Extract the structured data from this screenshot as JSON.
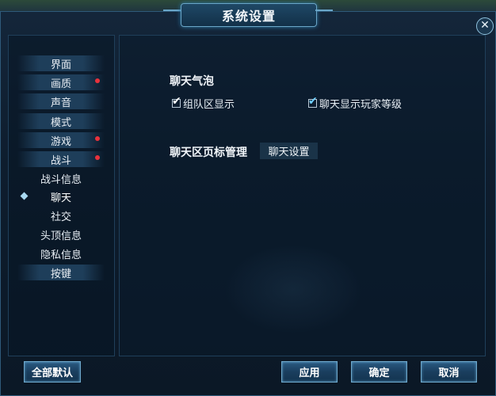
{
  "window": {
    "title": "系统设置"
  },
  "sidebar": {
    "items": [
      {
        "label": "界面",
        "style": "button",
        "has_dot": false
      },
      {
        "label": "画质",
        "style": "button",
        "has_dot": true
      },
      {
        "label": "声音",
        "style": "button",
        "has_dot": false
      },
      {
        "label": "模式",
        "style": "button",
        "has_dot": false
      },
      {
        "label": "游戏",
        "style": "button",
        "has_dot": true
      },
      {
        "label": "战斗",
        "style": "button",
        "has_dot": true
      },
      {
        "label": "战斗信息",
        "style": "plain",
        "has_dot": false
      },
      {
        "label": "聊天",
        "style": "plain",
        "has_dot": false,
        "active": true
      },
      {
        "label": "社交",
        "style": "plain",
        "has_dot": false
      },
      {
        "label": "头顶信息",
        "style": "plain",
        "has_dot": false
      },
      {
        "label": "隐私信息",
        "style": "plain",
        "has_dot": false
      },
      {
        "label": "按键",
        "style": "button",
        "has_dot": false
      }
    ]
  },
  "content": {
    "bubble_title": "聊天气泡",
    "checkbox_team": "组队区显示",
    "checkbox_level": "聊天显示玩家等级",
    "tab_manage_title": "聊天区页标管理",
    "chat_settings_button": "聊天设置"
  },
  "footer": {
    "reset_all": "全部默认",
    "apply": "应用",
    "confirm": "确定",
    "cancel": "取消"
  },
  "colors": {
    "accent_dot": "#e8323c",
    "panel_bg": "#0b1a2a",
    "border": "#6ea8cc"
  }
}
